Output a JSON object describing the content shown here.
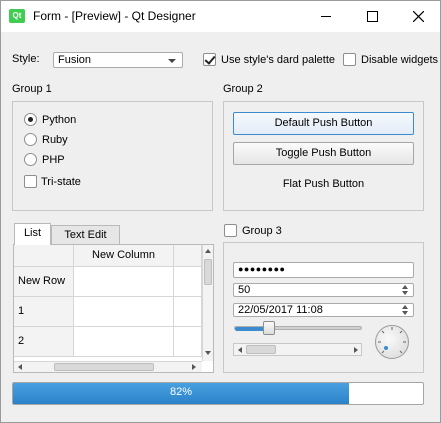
{
  "window": {
    "title": "Form - [Preview] - Qt Designer",
    "app_icon_text": "Qt"
  },
  "toolbar": {
    "style_label": "Style:",
    "style_value": "Fusion",
    "dark_palette_label": "Use style's dard palette",
    "dark_palette_checked": true,
    "disable_widgets_label": "Disable widgets",
    "disable_widgets_checked": false
  },
  "group1": {
    "title": "Group 1",
    "radios": [
      {
        "label": "Python",
        "checked": true
      },
      {
        "label": "Ruby",
        "checked": false
      },
      {
        "label": "PHP",
        "checked": false
      }
    ],
    "tristate_label": "Tri-state"
  },
  "group2": {
    "title": "Group 2",
    "default_button": "Default Push Button",
    "toggle_button": "Toggle Push Button",
    "flat_button": "Flat Push Button"
  },
  "tabs": {
    "list_tab": "List",
    "text_edit_tab": "Text Edit",
    "column_header": "New Column",
    "row_headers": [
      "New Row",
      "1",
      "2"
    ]
  },
  "group3": {
    "title": "Group 3",
    "password_mask": "●●●●●●●●",
    "spin_value": "50",
    "datetime_value": "22/05/2017 11:08",
    "slider_value_fraction": 0.27
  },
  "progress": {
    "value_text": "82%",
    "value_fraction": 0.82
  },
  "colors": {
    "accent": "#3a8bd0",
    "progress": "#2c82c9"
  }
}
